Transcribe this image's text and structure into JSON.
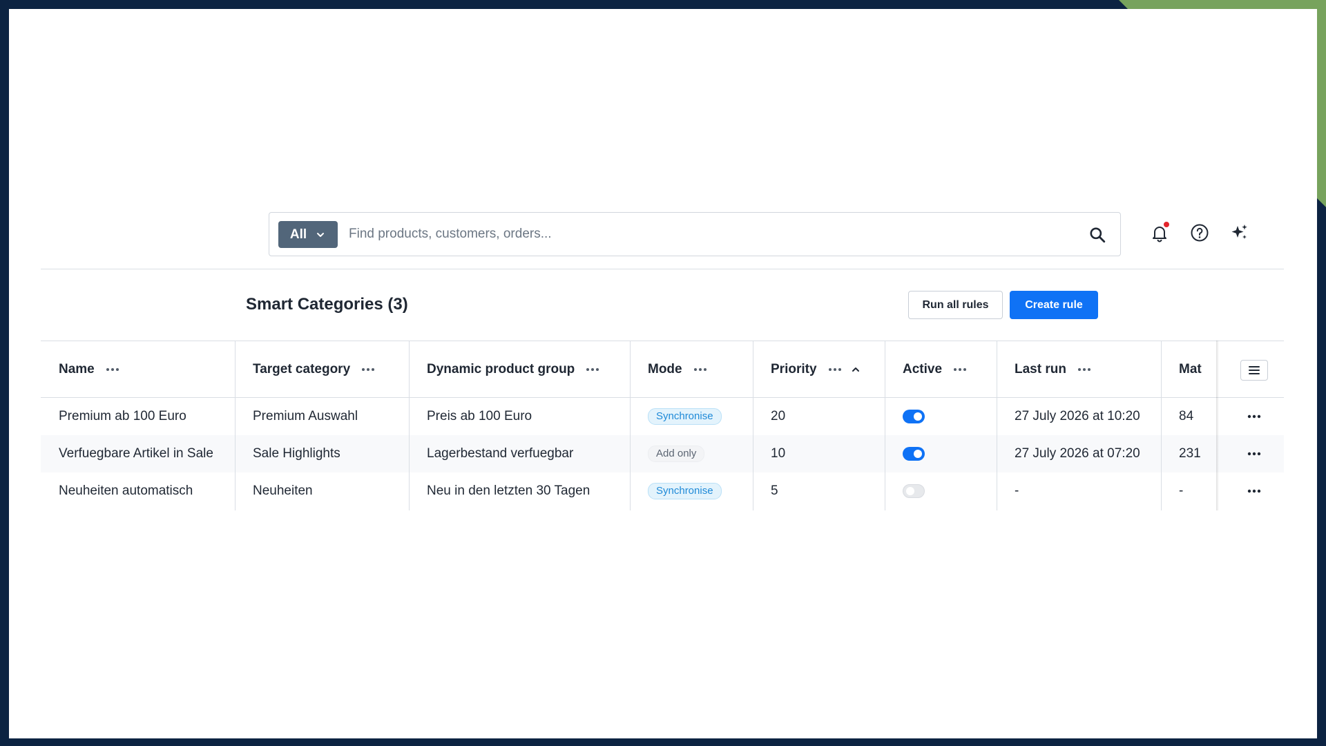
{
  "search": {
    "scope_label": "All",
    "placeholder": "Find products, customers, orders..."
  },
  "page": {
    "title": "Smart Categories (3)",
    "run_all_label": "Run all rules",
    "create_label": "Create rule"
  },
  "table": {
    "columns": {
      "name": "Name",
      "target": "Target category",
      "group": "Dynamic product group",
      "mode": "Mode",
      "priority": "Priority",
      "active": "Active",
      "last_run": "Last run",
      "matches": "Mat"
    },
    "sort": {
      "column": "Priority",
      "direction": "ascending"
    },
    "rows": [
      {
        "name": "Premium ab 100 Euro",
        "target": "Premium Auswahl",
        "group": "Preis ab 100 Euro",
        "mode": "Synchronise",
        "priority": "20",
        "active": true,
        "last_run": "27 July 2026 at 10:20",
        "matches": "84"
      },
      {
        "name": "Verfuegbare Artikel in Sale",
        "target": "Sale Highlights",
        "group": "Lagerbestand verfuegbar",
        "mode": "Add only",
        "priority": "10",
        "active": true,
        "last_run": "27 July 2026 at 07:20",
        "matches": "231"
      },
      {
        "name": "Neuheiten automatisch",
        "target": "Neuheiten",
        "group": "Neu in den letzten 30 Tagen",
        "mode": "Synchronise",
        "priority": "5",
        "active": false,
        "last_run": "-",
        "matches": "-"
      }
    ]
  },
  "icons": {
    "scope": "chevron-down-icon",
    "search": "search-icon",
    "notifications": "bell-icon",
    "help": "help-circle-icon",
    "ai": "sparkles-icon",
    "column_menu": "more-horizontal-icon",
    "sort": "chevron-up-icon",
    "column_settings": "list-icon"
  },
  "colors": {
    "primary": "#0f72f5",
    "frame": "#0c2342",
    "accent_corner": "#77a35d",
    "notification_dot": "#e3242b"
  }
}
